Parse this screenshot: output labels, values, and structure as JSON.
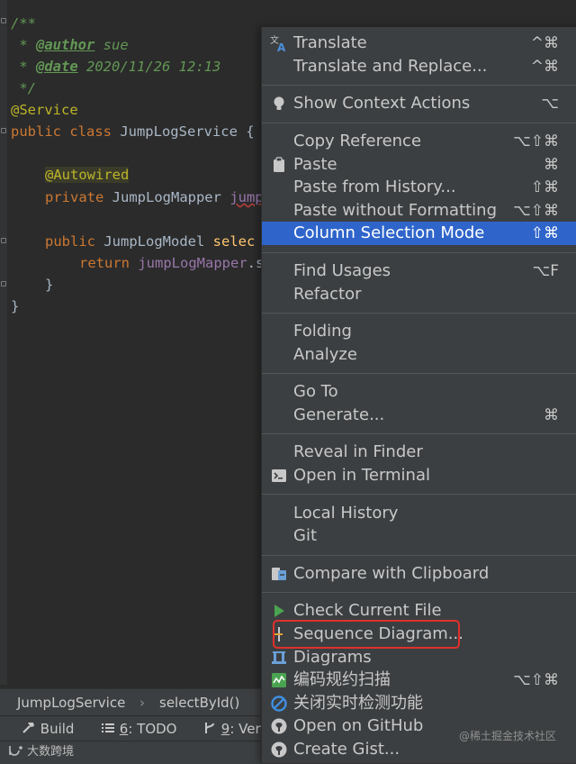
{
  "editor": {
    "lines": [
      {
        "text": "/**"
      },
      {
        "prefix": " * ",
        "tag": "@author",
        "rest": " sue"
      },
      {
        "prefix": " * ",
        "tag": "@date",
        "rest": " 2020/11/26 12:13"
      },
      {
        "text": " */"
      },
      {
        "anno": "@Service"
      },
      {
        "kw": "public class",
        "rest": " JumpLogService {"
      },
      {
        "anno": "@Autowired"
      },
      {
        "kw": "private",
        "type": " JumpLogMapper ",
        "field": "jump"
      },
      {
        "kw": "public",
        "rest": " JumpLogModel ",
        "method": "selec"
      },
      {
        "kw": "return",
        "field": " jumpLogMapper",
        "rest": ".s"
      },
      {
        "text": "}"
      },
      {
        "text": "}"
      }
    ]
  },
  "breadcrumb": {
    "class": "JumpLogService",
    "sep": "›",
    "method": "selectById()"
  },
  "tool_windows": {
    "build": "Build",
    "todo_num": "6",
    "todo": ": TODO",
    "vcs_num": "9",
    "vcs": ": Vers"
  },
  "watermarks": {
    "left": "大数跨境",
    "right": "@稀土掘金技术社区"
  },
  "menu": {
    "items": [
      {
        "label": "Translate",
        "shortcut": "^⌘",
        "icon": "translate-icon"
      },
      {
        "label": "Translate and Replace...",
        "shortcut": "^⌘"
      },
      {
        "label": "Show Context Actions",
        "shortcut": "⌥",
        "icon": "lightbulb-icon"
      },
      {
        "label": "Copy Reference",
        "shortcut": "⌥⇧⌘"
      },
      {
        "label": "Paste",
        "shortcut": "⌘",
        "icon": "clipboard-icon"
      },
      {
        "label": "Paste from History...",
        "shortcut": "⇧⌘"
      },
      {
        "label": "Paste without Formatting",
        "shortcut": "⌥⇧⌘"
      },
      {
        "label": "Column Selection Mode",
        "shortcut": "⇧⌘",
        "selected": true
      },
      {
        "label": "Find Usages",
        "shortcut": "⌥F"
      },
      {
        "label": "Refactor"
      },
      {
        "label": "Folding"
      },
      {
        "label": "Analyze"
      },
      {
        "label": "Go To"
      },
      {
        "label": "Generate...",
        "shortcut": "⌘"
      },
      {
        "label": "Reveal in Finder"
      },
      {
        "label": "Open in Terminal",
        "icon": "terminal-icon"
      },
      {
        "label": "Local History"
      },
      {
        "label": "Git"
      },
      {
        "label": "Compare with Clipboard",
        "icon": "compare-icon"
      },
      {
        "label": "Check Current File",
        "icon": "play-icon"
      },
      {
        "label": "Sequence Diagram...",
        "icon": "sequence-diagram-icon"
      },
      {
        "label": "Diagrams",
        "icon": "diagrams-icon"
      },
      {
        "label": "编码规约扫描",
        "shortcut": "⌥⇧⌘",
        "icon": "code-scan-icon"
      },
      {
        "label": "关闭实时检测功能",
        "icon": "disable-icon"
      },
      {
        "label": "Open on GitHub",
        "icon": "github-icon"
      },
      {
        "label": "Create Gist...",
        "icon": "github-icon"
      }
    ]
  }
}
